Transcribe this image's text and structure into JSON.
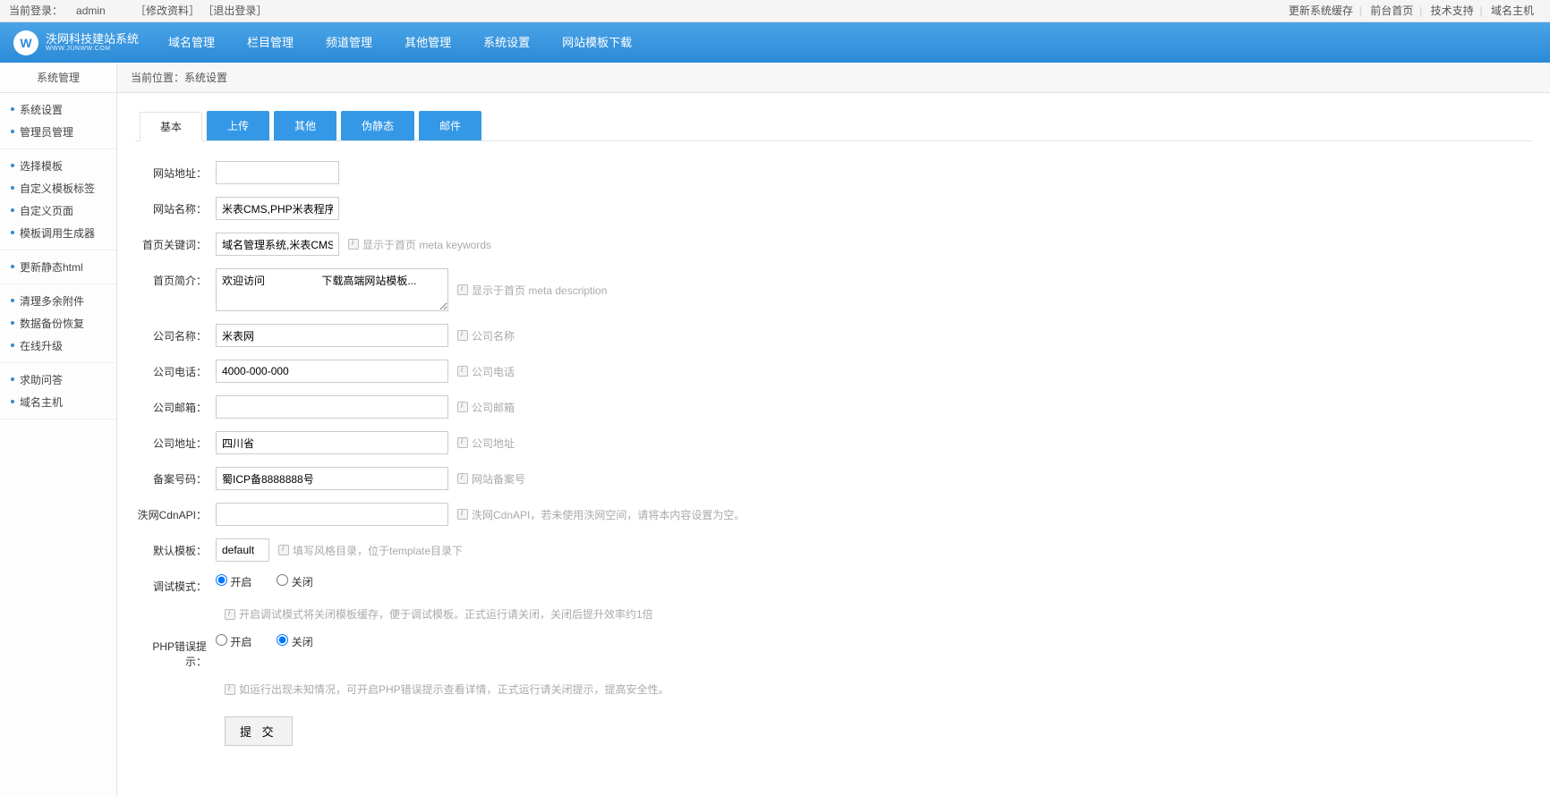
{
  "topbar": {
    "login_prefix": "当前登录：",
    "user": "admin",
    "edit_profile": "［修改资料］",
    "logout": "［退出登录］",
    "links": [
      "更新系统缓存",
      "前台首页",
      "技术支持",
      "域名主机"
    ]
  },
  "logo": {
    "title": "泆网科技建站系统",
    "sub": "WWW.JUNWW.COM"
  },
  "mainnav": [
    "域名管理",
    "栏目管理",
    "频道管理",
    "其他管理",
    "系统设置",
    "网站模板下载"
  ],
  "sidebar": {
    "title": "系统管理",
    "groups": [
      [
        "系统设置",
        "管理员管理"
      ],
      [
        "选择模板",
        "自定义模板标签",
        "自定义页面",
        "模板调用生成器"
      ],
      [
        "更新静态html"
      ],
      [
        "清理多余附件",
        "数据备份恢复",
        "在线升级"
      ],
      [
        "求助问答",
        "域名主机"
      ]
    ]
  },
  "breadcrumb": {
    "prefix": "当前位置：",
    "value": "系统设置"
  },
  "tabs": [
    "基本",
    "上传",
    "其他",
    "伪静态",
    "邮件"
  ],
  "form": {
    "site_url": {
      "label": "网站地址：",
      "value": ""
    },
    "site_name": {
      "label": "网站名称：",
      "value": "米表CMS,PHP米表程序,htr"
    },
    "keywords": {
      "label": "首页关键词：",
      "value": "域名管理系统,米表CMS,米",
      "hint": "显示于首页 meta keywords"
    },
    "desc": {
      "label": "首页简介：",
      "value": "欢迎访问                   下载高端网站模板...",
      "hint": "显示于首页 meta description"
    },
    "company": {
      "label": "公司名称：",
      "value": "米表网",
      "hint": "公司名称"
    },
    "tel": {
      "label": "公司电话：",
      "value": "4000-000-000",
      "hint": "公司电话"
    },
    "email": {
      "label": "公司邮箱：",
      "value": "",
      "hint": "公司邮箱"
    },
    "address": {
      "label": "公司地址：",
      "value": "四川省",
      "hint": "公司地址"
    },
    "icp": {
      "label": "备案号码：",
      "value": "蜀ICP备8888888号",
      "hint": "网站备案号"
    },
    "cdn": {
      "label": "泆网CdnAPI：",
      "value": "",
      "hint": "泆网CdnAPI，若未使用泆网空间，请将本内容设置为空。"
    },
    "template": {
      "label": "默认模板：",
      "value": "default",
      "hint": "填写风格目录，位于template目录下"
    },
    "debug": {
      "label": "调试模式：",
      "on": "开启",
      "off": "关闭",
      "note": "开启调试模式将关闭模板缓存，便于调试模板。正式运行请关闭，关闭后提升效率约1倍"
    },
    "php_error": {
      "label": "PHP错误提示：",
      "on": "开启",
      "off": "关闭",
      "note": "如运行出现未知情况，可开启PHP错误提示查看详情，正式运行请关闭提示，提高安全性。"
    },
    "submit": "提 交"
  }
}
